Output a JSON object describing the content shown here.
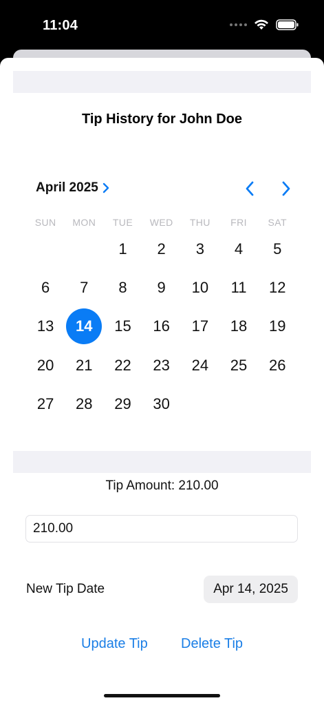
{
  "status_bar": {
    "time": "11:04",
    "icons": [
      "signal-icon",
      "wifi-icon",
      "battery-icon"
    ]
  },
  "sheet": {
    "title": "Tip History for John Doe"
  },
  "calendar": {
    "month_label": "April 2025",
    "weekdays": [
      "SUN",
      "MON",
      "TUE",
      "WED",
      "THU",
      "FRI",
      "SAT"
    ],
    "leading_blanks": 2,
    "days": [
      "1",
      "2",
      "3",
      "4",
      "5",
      "6",
      "7",
      "8",
      "9",
      "10",
      "11",
      "12",
      "13",
      "14",
      "15",
      "16",
      "17",
      "18",
      "19",
      "20",
      "21",
      "22",
      "23",
      "24",
      "25",
      "26",
      "27",
      "28",
      "29",
      "30"
    ],
    "selected_day": "14",
    "accent_color": "#0a7cf5"
  },
  "tip": {
    "amount_label": "Tip Amount: 210.00",
    "amount_value": "210.00"
  },
  "new_tip_date": {
    "label": "New Tip Date",
    "value": "Apr 14, 2025"
  },
  "actions": {
    "update_label": "Update Tip",
    "delete_label": "Delete Tip"
  }
}
